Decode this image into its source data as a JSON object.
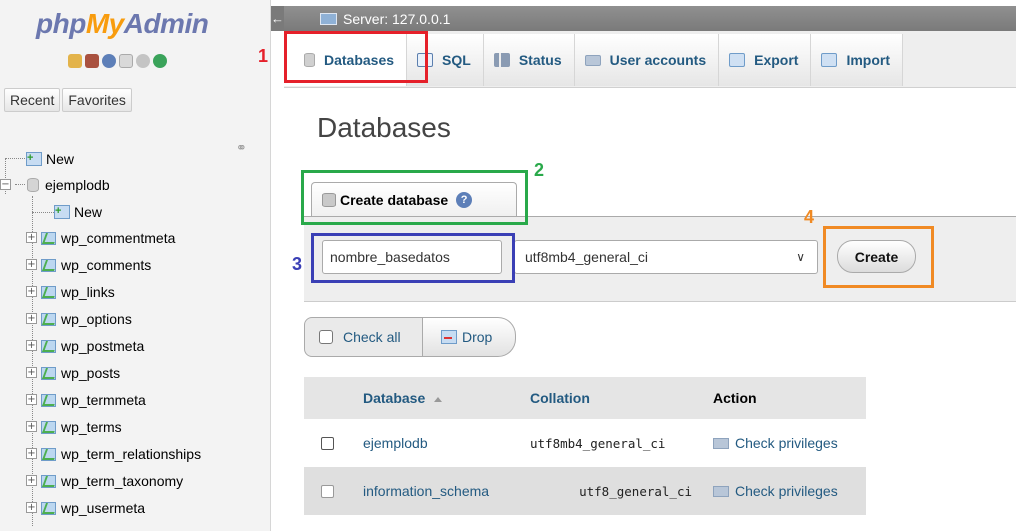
{
  "nav": {
    "logo": {
      "php": "php",
      "my": "My",
      "admin": "Admin"
    },
    "tabs": [
      "Recent",
      "Favorites"
    ],
    "tree": {
      "new_root": "New",
      "database": "ejemplodb",
      "new_table": "New",
      "tables": [
        "wp_commentmeta",
        "wp_comments",
        "wp_links",
        "wp_options",
        "wp_postmeta",
        "wp_posts",
        "wp_termmeta",
        "wp_terms",
        "wp_term_relationships",
        "wp_term_taxonomy",
        "wp_usermeta"
      ]
    }
  },
  "breadcrumb": {
    "server": "Server: 127.0.0.1"
  },
  "tabs": [
    "Databases",
    "SQL",
    "Status",
    "User accounts",
    "Export",
    "Import"
  ],
  "main": {
    "title": "Databases",
    "create_tab": "Create database",
    "db_name_value": "nombre_basedatos",
    "collation_selected": "utf8mb4_general_ci",
    "create_button": "Create",
    "check_all": "Check all",
    "drop": "Drop"
  },
  "table": {
    "headers": [
      "Database",
      "Collation",
      "Action"
    ],
    "rows": [
      {
        "name": "ejemplodb",
        "collation": "utf8mb4_general_ci",
        "action": "Check privileges"
      },
      {
        "name": "information_schema",
        "collation": "utf8_general_ci",
        "action": "Check privileges"
      }
    ]
  },
  "annotations": [
    "1",
    "2",
    "3",
    "4"
  ],
  "colors": {
    "red": "#e5202a",
    "green": "#29a94a",
    "blue": "#3a3fb5",
    "orange": "#f08a24",
    "link": "#235a81"
  }
}
